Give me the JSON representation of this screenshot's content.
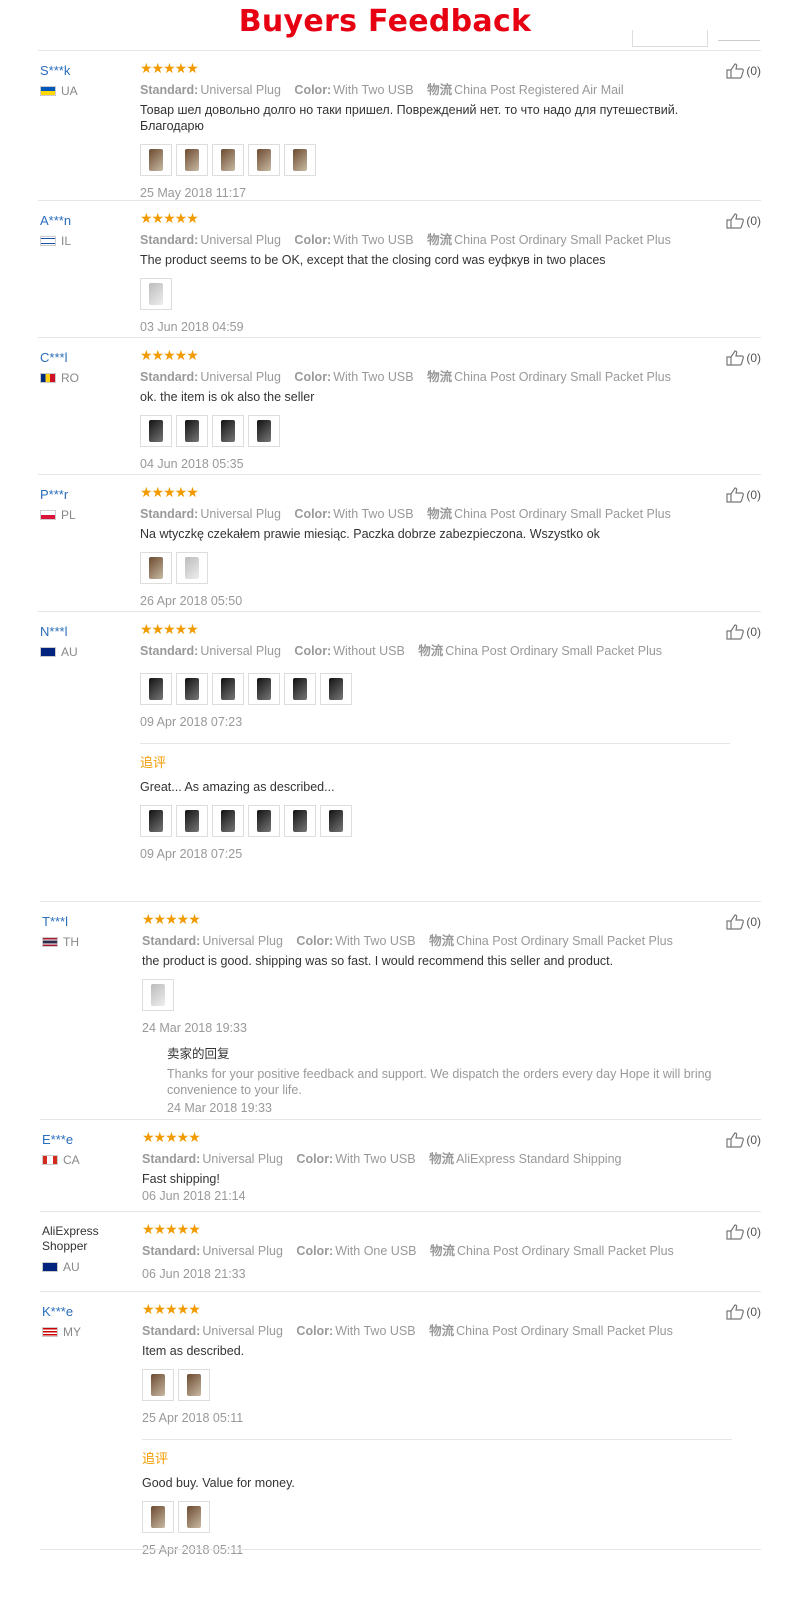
{
  "banner": {
    "title": "Buyers Feedback"
  },
  "labels": {
    "standard": "Standard:",
    "color": "Color:",
    "shipping": "物流",
    "additional": "追评",
    "seller_reply": "卖家的回复"
  },
  "reviews": [
    {
      "user": "S***k",
      "country": "UA",
      "flag": "ua",
      "standard": "Universal Plug",
      "color": "With Two USB",
      "shipping": "China Post Registered Air Mail",
      "text": "Товар шел довольно долго но таки пришел. Повреждений нет. то что надо для путешествий. Благодарю",
      "date": "25 May 2018 11:17",
      "helpful": "(0)"
    },
    {
      "user": "A***n",
      "country": "IL",
      "flag": "il",
      "standard": "Universal Plug",
      "color": "With Two USB",
      "shipping": "China Post Ordinary Small Packet Plus",
      "text": "The product seems to be OK, except that the closing cord was еуфкув in two places",
      "date": "03 Jun 2018 04:59",
      "helpful": "(0)"
    },
    {
      "user": "C***l",
      "country": "RO",
      "flag": "ro",
      "standard": "Universal Plug",
      "color": "With Two USB",
      "shipping": "China Post Ordinary Small Packet Plus",
      "text": "ok. the item is ok also the seller",
      "date": "04 Jun 2018 05:35",
      "helpful": "(0)"
    },
    {
      "user": "P***r",
      "country": "PL",
      "flag": "pl",
      "standard": "Universal Plug",
      "color": "With Two USB",
      "shipping": "China Post Ordinary Small Packet Plus",
      "text": "Na wtyczkę czekałem prawie miesiąc. Paczka dobrze zabezpieczona. Wszystko ok",
      "date": "26 Apr 2018 05:50",
      "helpful": "(0)"
    },
    {
      "user": "N***l",
      "country": "AU",
      "flag": "au",
      "standard": "Universal Plug",
      "color": "Without USB",
      "shipping": "China Post Ordinary Small Packet Plus",
      "date": "09 Apr 2018 07:23",
      "helpful": "(0)",
      "followup": {
        "text": "Great... As amazing as described...",
        "date": "09 Apr 2018 07:25"
      }
    },
    {
      "user": "T***l",
      "country": "TH",
      "flag": "th",
      "standard": "Universal Plug",
      "color": "With Two USB",
      "shipping": "China Post Ordinary Small Packet Plus",
      "text": "the product is good. shipping was so fast. I would recommend this seller and product.",
      "date": "24 Mar 2018 19:33",
      "helpful": "(0)",
      "reply": {
        "text": "Thanks for your positive feedback and support. We dispatch the orders every day Hope it will bring convenience to your life.",
        "date": "24 Mar 2018 19:33"
      }
    },
    {
      "user": "E***e",
      "country": "CA",
      "flag": "ca",
      "standard": "Universal Plug",
      "color": "With Two USB",
      "shipping": "AliExpress Standard Shipping",
      "text": "Fast shipping!",
      "date": "06 Jun 2018 21:14",
      "helpful": "(0)"
    },
    {
      "user": "AliExpress Shopper",
      "country": "AU",
      "flag": "au",
      "standard": "Universal Plug",
      "color": "With One USB",
      "shipping": "China Post Ordinary Small Packet Plus",
      "date": "06 Jun 2018 21:33",
      "helpful": "(0)"
    },
    {
      "user": "K***e",
      "country": "MY",
      "flag": "my",
      "standard": "Universal Plug",
      "color": "With Two USB",
      "shipping": "China Post Ordinary Small Packet Plus",
      "text": "Item as described.",
      "date": "25 Apr 2018 05:11",
      "helpful": "(0)",
      "followup": {
        "text": "Good buy. Value for money.",
        "date": "25 Apr 2018 05:11"
      }
    }
  ]
}
